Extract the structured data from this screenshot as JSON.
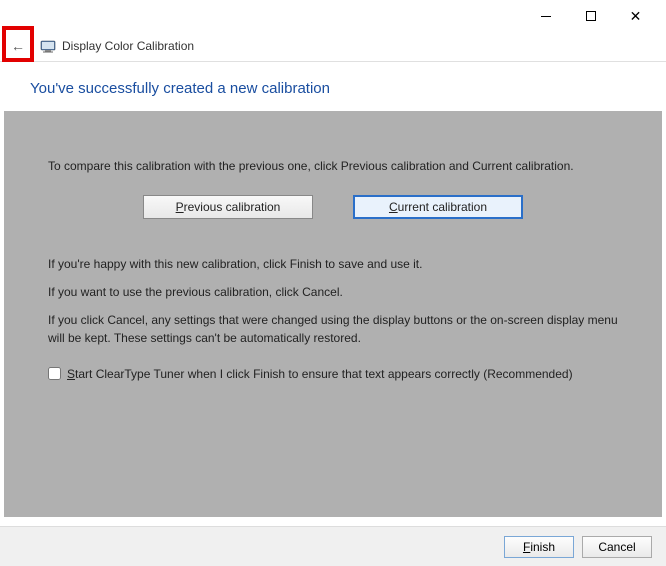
{
  "window": {
    "app_title": "Display Color Calibration"
  },
  "headline": "You've successfully created a new calibration",
  "panel": {
    "compare_text": "To compare this calibration with the previous one, click Previous calibration and Current calibration.",
    "prev_btn_pre": "P",
    "prev_btn_post": "revious calibration",
    "curr_btn_pre": "C",
    "curr_btn_post": "urrent calibration",
    "happy_text": "If you're happy with this new calibration, click Finish to save and use it.",
    "use_prev_text": "If you want to use the previous calibration, click Cancel.",
    "cancel_warn_text": "If you click Cancel, any settings that were changed using the display buttons or the on-screen display menu will be kept. These settings can't be automatically restored.",
    "checkbox_pre": "S",
    "checkbox_post": "tart ClearType Tuner when I click Finish to ensure that text appears correctly (Recommended)"
  },
  "footer": {
    "finish_pre": "F",
    "finish_post": "inish",
    "cancel_label": "Cancel"
  }
}
